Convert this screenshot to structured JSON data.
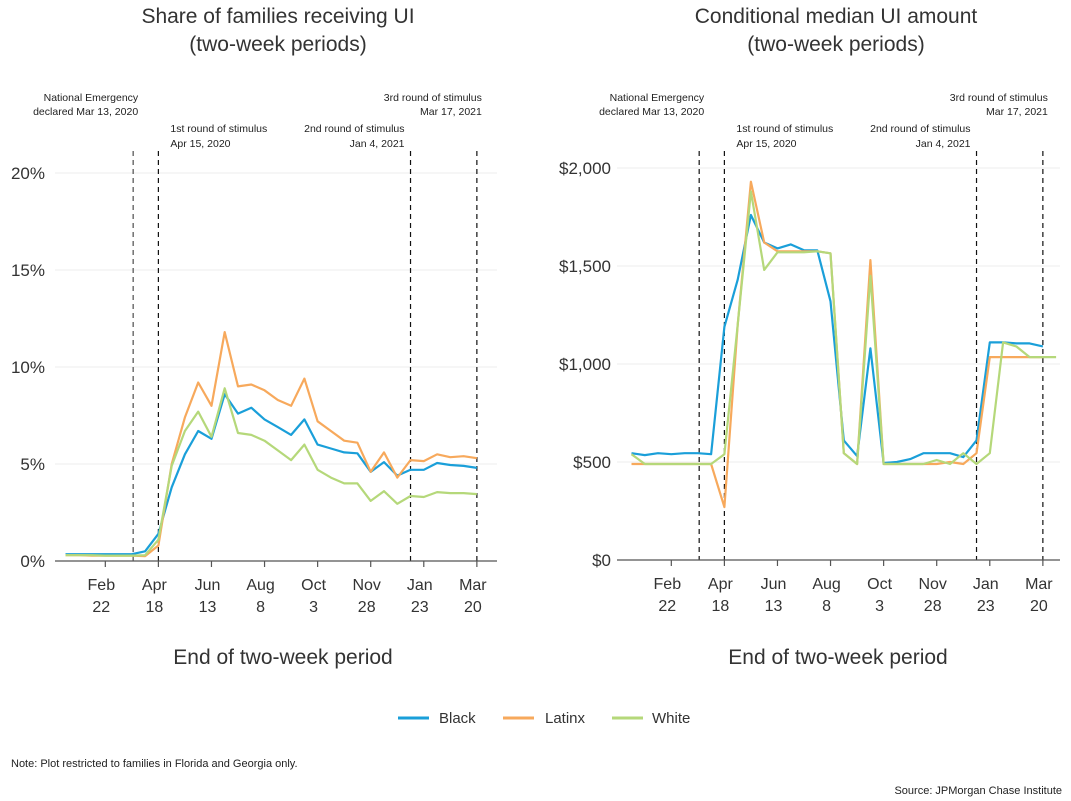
{
  "legend": [
    {
      "name": "Black",
      "color": "#1a9fd9"
    },
    {
      "name": "Latinx",
      "color": "#f7a95c"
    },
    {
      "name": "White",
      "color": "#b5d87a"
    }
  ],
  "note": "Note: Plot restricted to families in Florida and Georgia only.",
  "source": "Source: JPMorgan Chase Institute",
  "chart_data": [
    {
      "type": "line",
      "title": "Share of families receiving UI",
      "subtitle": "(two-week periods)",
      "xlabel": "End of two-week period",
      "ylabel": "",
      "x_tick_labels": [
        [
          "Feb",
          "22"
        ],
        [
          "Apr",
          "18"
        ],
        [
          "Jun",
          "13"
        ],
        [
          "Aug",
          "8"
        ],
        [
          "Oct",
          "3"
        ],
        [
          "Nov",
          "28"
        ],
        [
          "Jan",
          "23"
        ],
        [
          "Mar",
          "20"
        ]
      ],
      "x_tick_periods": [
        3,
        7,
        11,
        15,
        19,
        23,
        27,
        31
      ],
      "y_ticks": [
        0,
        5,
        10,
        15,
        20
      ],
      "y_tick_labels": [
        "0%",
        "5%",
        "10%",
        "15%",
        "20%"
      ],
      "ylim": [
        0,
        20
      ],
      "xlim_periods": [
        -0.8,
        32.5
      ],
      "grid": true,
      "legend_position": "bottom",
      "annotations": [
        {
          "period": 5.1,
          "lines": [
            "National Emergency",
            "declared Mar 13, 2020"
          ],
          "align": "end",
          "row": "top",
          "style": "grey"
        },
        {
          "period": 7.0,
          "lines": [
            "1st round of stimulus",
            "Apr 15, 2020"
          ],
          "align": "start",
          "row": "low",
          "style": "black"
        },
        {
          "period": 26.0,
          "lines": [
            "2nd round of stimulus",
            "Jan 4, 2021"
          ],
          "align": "end",
          "row": "low",
          "style": "black"
        },
        {
          "period": 31.0,
          "lines": [
            "3rd round of stimulus",
            "Mar 17, 2021"
          ],
          "align": "end",
          "row": "top",
          "style": "black"
        }
      ],
      "series": [
        {
          "name": "Black",
          "values": [
            0.35,
            0.35,
            0.35,
            0.35,
            0.35,
            0.35,
            0.5,
            1.4,
            3.8,
            5.5,
            6.7,
            6.3,
            8.6,
            7.6,
            7.9,
            7.3,
            6.9,
            6.5,
            7.3,
            6.0,
            5.8,
            5.6,
            5.55,
            4.6,
            5.1,
            4.4,
            4.7,
            4.7,
            5.05,
            4.95,
            4.9,
            4.8
          ]
        },
        {
          "name": "Latinx",
          "values": [
            0.3,
            0.3,
            0.28,
            0.28,
            0.28,
            0.28,
            0.25,
            0.8,
            5.0,
            7.4,
            9.2,
            8.0,
            11.8,
            9.0,
            9.1,
            8.8,
            8.3,
            8.0,
            9.4,
            7.2,
            6.7,
            6.2,
            6.1,
            4.6,
            5.6,
            4.3,
            5.2,
            5.15,
            5.5,
            5.35,
            5.4,
            5.3
          ]
        },
        {
          "name": "White",
          "values": [
            0.3,
            0.3,
            0.3,
            0.28,
            0.28,
            0.28,
            0.3,
            1.1,
            4.9,
            6.7,
            7.7,
            6.4,
            8.9,
            6.6,
            6.5,
            6.2,
            5.7,
            5.2,
            6.0,
            4.7,
            4.3,
            4.0,
            4.0,
            3.1,
            3.6,
            2.95,
            3.35,
            3.3,
            3.55,
            3.5,
            3.5,
            3.45
          ]
        }
      ]
    },
    {
      "type": "line",
      "title": "Conditional median UI amount",
      "subtitle": "(two-week periods)",
      "xlabel": "End of two-week period",
      "ylabel": "",
      "x_tick_labels": [
        [
          "Feb",
          "22"
        ],
        [
          "Apr",
          "18"
        ],
        [
          "Jun",
          "13"
        ],
        [
          "Aug",
          "8"
        ],
        [
          "Oct",
          "3"
        ],
        [
          "Nov",
          "28"
        ],
        [
          "Jan",
          "23"
        ],
        [
          "Mar",
          "20"
        ]
      ],
      "x_tick_periods": [
        3,
        7,
        11,
        15,
        19,
        23,
        27,
        31
      ],
      "y_ticks": [
        0,
        500,
        1000,
        1500,
        2000
      ],
      "y_tick_labels": [
        "$0",
        "$500",
        "$1,000",
        "$1,500",
        "$2,000"
      ],
      "ylim": [
        0,
        2000
      ],
      "xlim_periods": [
        -0.8,
        32.5
      ],
      "grid": true,
      "legend_position": "bottom",
      "annotations": [
        {
          "period": 5.1,
          "lines": [
            "National Emergency",
            "declared Mar 13, 2020"
          ],
          "align": "end",
          "row": "top",
          "style": "black"
        },
        {
          "period": 7.0,
          "lines": [
            "1st round of stimulus",
            "Apr 15, 2020"
          ],
          "align": "start",
          "row": "low",
          "style": "black"
        },
        {
          "period": 26.0,
          "lines": [
            "2nd round of stimulus",
            "Jan 4, 2021"
          ],
          "align": "end",
          "row": "low",
          "style": "black"
        },
        {
          "period": 31.0,
          "lines": [
            "3rd round of stimulus",
            "Mar 17, 2021"
          ],
          "align": "end",
          "row": "top",
          "style": "black"
        }
      ],
      "series": [
        {
          "name": "Black",
          "values": [
            545,
            535,
            545,
            540,
            545,
            545,
            540,
            1190,
            1430,
            1760,
            1620,
            1590,
            1610,
            1580,
            1580,
            1320,
            610,
            530,
            1080,
            495,
            500,
            515,
            545,
            545,
            545,
            525,
            610,
            1110,
            1110,
            1105,
            1105,
            1090
          ]
        },
        {
          "name": "Latinx",
          "values": [
            490,
            490,
            490,
            490,
            490,
            490,
            490,
            270,
            1200,
            1930,
            1620,
            1575,
            1575,
            1575,
            1575,
            1565,
            545,
            490,
            1530,
            490,
            490,
            490,
            490,
            490,
            500,
            490,
            545,
            1035,
            1035,
            1035,
            1035,
            1035
          ]
        },
        {
          "name": "White",
          "values": [
            540,
            490,
            490,
            490,
            490,
            490,
            490,
            540,
            1200,
            1880,
            1480,
            1570,
            1570,
            1570,
            1575,
            1565,
            545,
            490,
            1450,
            490,
            490,
            490,
            490,
            510,
            490,
            545,
            490,
            545,
            1110,
            1090,
            1035,
            1035,
            1035
          ]
        }
      ]
    }
  ]
}
